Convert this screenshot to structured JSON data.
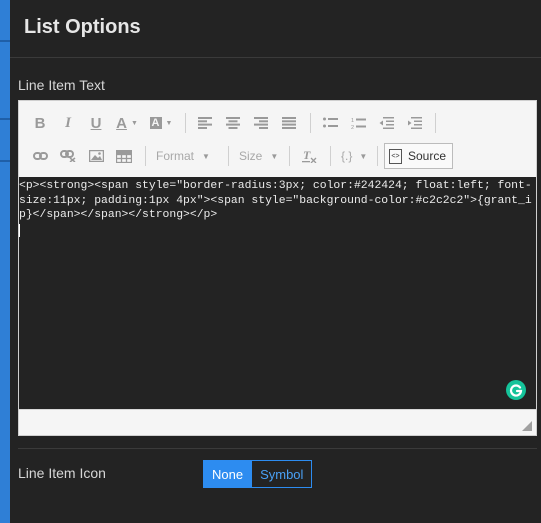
{
  "panel": {
    "title": "List Options"
  },
  "line_item_text": {
    "label": "Line Item Text",
    "toolbar": {
      "format_label": "Format",
      "size_label": "Size",
      "placeholder_label": "{.}",
      "source_label": "Source"
    },
    "source_code": "<p><strong><span style=\"border-radius:3px; color:#242424; float:left; font-size:11px; padding:1px 4px\"><span style=\"background-color:#c2c2c2\">{grant_ip}</span></span></strong></p>"
  },
  "line_item_icon": {
    "label": "Line Item Icon",
    "options": [
      "None",
      "Symbol"
    ],
    "selected": "None"
  },
  "colors": {
    "accent": "#2d8cf0",
    "panel_bg": "#232323",
    "grammarly": "#15c39a"
  }
}
